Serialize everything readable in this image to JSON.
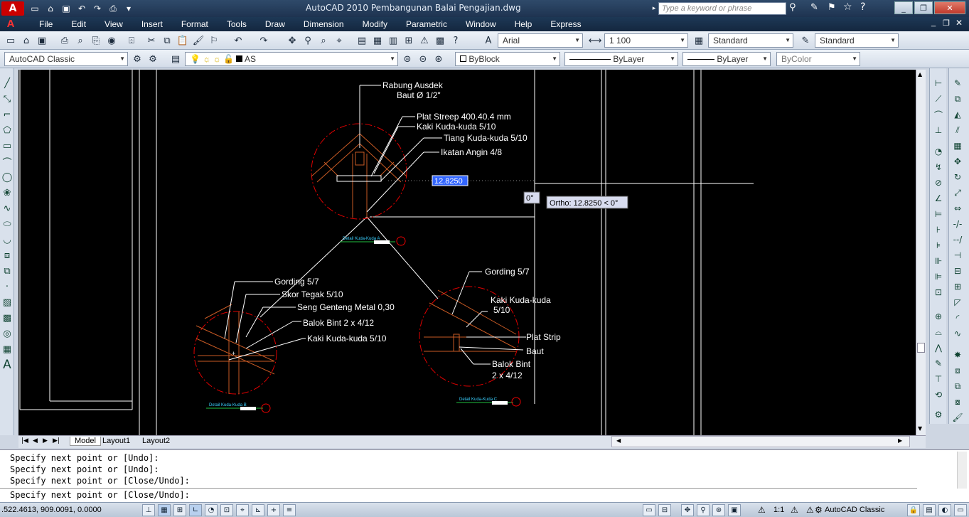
{
  "window": {
    "title": "AutoCAD 2010     Pembangunan Balai Pengajian.dwg",
    "search_placeholder": "Type a keyword or phrase"
  },
  "menu": [
    "File",
    "Edit",
    "View",
    "Insert",
    "Format",
    "Tools",
    "Draw",
    "Dimension",
    "Modify",
    "Parametric",
    "Window",
    "Help",
    "Express"
  ],
  "toolbar1": {
    "text_style": "Arial",
    "dim_scale": "1 100",
    "dim_style": "Standard",
    "table_style": "Standard"
  },
  "toolbar2": {
    "workspace": "AutoCAD Classic",
    "layer": "AS",
    "color": "ByBlock",
    "linetype": "ByLayer",
    "lineweight": "ByLayer",
    "plotstyle": "ByColor"
  },
  "drawing": {
    "labels_top": [
      "Rabung Ausdek",
      "Baut Ø 1/2\"",
      "Plat Streep 400.40.4 mm",
      "Kaki Kuda-kuda 5/10",
      "Tiang Kuda-kuda 5/10",
      "Ikatan Angin 4/8"
    ],
    "labels_left": [
      "Gording 5/7",
      "Skor Tegak 5/10",
      "Seng Genteng Metal 0,30",
      "Balok Bint 2 x 4/12",
      "Kaki Kuda-kuda 5/10"
    ],
    "labels_right": [
      "Gording 5/7",
      "Kaki Kuda-kuda",
      "5/10",
      "Plat Strip",
      "Baut",
      "Balok Bint",
      "2 x 4/12"
    ],
    "detail_a": "Detail Kuda-Kuda A",
    "detail_b": "Detail Kuda-Kuda B",
    "detail_c": "Detail Kuda-Kuda C",
    "dyn_input": "12.8250",
    "angle": "0°",
    "ortho": "Ortho: 12.8250 < 0°"
  },
  "tabs": [
    "Model",
    "Layout1",
    "Layout2"
  ],
  "command": {
    "lines": [
      "Specify next point or [Undo]:",
      "Specify next point or [Undo]:",
      "Specify next point or [Close/Undo]:"
    ],
    "prompt": "Specify next point or [Close/Undo]:"
  },
  "status": {
    "coords": ".522.4613, 909.0091, 0.0000",
    "scale": "1:1",
    "workspace": "AutoCAD Classic"
  }
}
